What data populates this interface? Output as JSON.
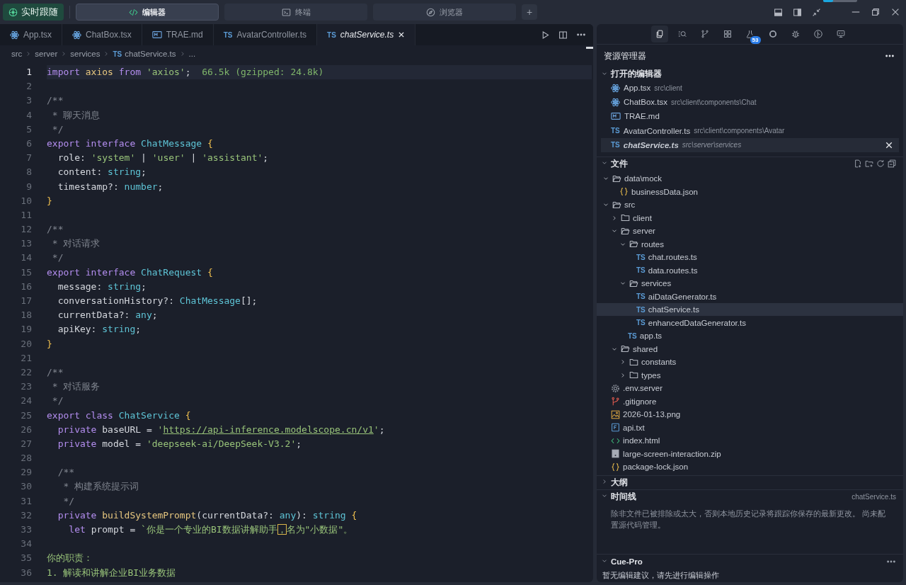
{
  "top_bar": {
    "follow_button": "实时跟随",
    "mode_tabs": [
      {
        "label": "编辑器",
        "kind": "code",
        "selected": true
      },
      {
        "label": "终端",
        "kind": "terminal",
        "selected": false
      },
      {
        "label": "浏览器",
        "kind": "compass",
        "selected": false
      }
    ],
    "add_button": "+",
    "progress": {
      "level": 0.3
    }
  },
  "editor": {
    "tabs": [
      {
        "label": "App.tsx",
        "kind": "react",
        "selected": false
      },
      {
        "label": "ChatBox.tsx",
        "kind": "react",
        "selected": false
      },
      {
        "label": "TRAE.md",
        "kind": "md",
        "selected": false
      },
      {
        "label": "AvatarController.ts",
        "kind": "ts",
        "icon_text": "TS",
        "selected": false
      },
      {
        "label": "chatService.ts",
        "kind": "ts",
        "icon_text": "TS",
        "selected": true
      }
    ],
    "breadcrumb": [
      {
        "text": "src"
      },
      {
        "text": "server"
      },
      {
        "text": "services"
      },
      {
        "text": "chatService.ts",
        "icon_text": "TS"
      },
      {
        "text": "..."
      }
    ],
    "lines": [
      {
        "number": "1",
        "current": true,
        "tokens": [
          {
            "kind": "keyword",
            "text": "import"
          },
          {
            "kind": "variable",
            "text": " axios "
          },
          {
            "kind": "keyword",
            "text": "from"
          },
          {
            "kind": "string",
            "text": " 'axios'"
          },
          {
            "kind": "plain",
            "text": ";"
          },
          {
            "kind": "hint",
            "text": "  66.5k (gzipped: 24.8k)"
          }
        ]
      },
      {
        "number": "2",
        "current": false
      },
      {
        "number": "3",
        "current": false,
        "tokens": [
          {
            "kind": "comment",
            "text": "/**"
          }
        ]
      },
      {
        "number": "4",
        "current": false,
        "tokens": [
          {
            "kind": "comment",
            "text": " * 聊天消息"
          }
        ]
      },
      {
        "number": "5",
        "current": false,
        "tokens": [
          {
            "kind": "comment",
            "text": " */"
          }
        ]
      },
      {
        "number": "6",
        "current": false,
        "tokens": [
          {
            "kind": "keyword",
            "text": "export interface "
          },
          {
            "kind": "class",
            "text": "ChatMessage "
          },
          {
            "kind": "brace",
            "text": "{"
          }
        ]
      },
      {
        "number": "7",
        "current": false,
        "tokens": [
          {
            "kind": "plain",
            "text": "  role: "
          },
          {
            "kind": "string",
            "text": "'system'"
          },
          {
            "kind": "plain",
            "text": " | "
          },
          {
            "kind": "string",
            "text": "'user'"
          },
          {
            "kind": "plain",
            "text": " | "
          },
          {
            "kind": "string",
            "text": "'assistant'"
          },
          {
            "kind": "plain",
            "text": ";"
          }
        ]
      },
      {
        "number": "8",
        "current": false,
        "tokens": [
          {
            "kind": "plain",
            "text": "  content: "
          },
          {
            "kind": "type",
            "text": "string"
          },
          {
            "kind": "plain",
            "text": ";"
          }
        ]
      },
      {
        "number": "9",
        "current": false,
        "tokens": [
          {
            "kind": "plain",
            "text": "  timestamp?: "
          },
          {
            "kind": "type",
            "text": "number"
          },
          {
            "kind": "plain",
            "text": ";"
          }
        ]
      },
      {
        "number": "10",
        "current": false,
        "tokens": [
          {
            "kind": "brace",
            "text": "}"
          }
        ]
      },
      {
        "number": "11",
        "current": false
      },
      {
        "number": "12",
        "current": false,
        "tokens": [
          {
            "kind": "comment",
            "text": "/**"
          }
        ]
      },
      {
        "number": "13",
        "current": false,
        "tokens": [
          {
            "kind": "comment",
            "text": " * 对话请求"
          }
        ]
      },
      {
        "number": "14",
        "current": false,
        "tokens": [
          {
            "kind": "comment",
            "text": " */"
          }
        ]
      },
      {
        "number": "15",
        "current": false,
        "tokens": [
          {
            "kind": "keyword",
            "text": "export interface "
          },
          {
            "kind": "class",
            "text": "ChatRequest "
          },
          {
            "kind": "brace",
            "text": "{"
          }
        ]
      },
      {
        "number": "16",
        "current": false,
        "tokens": [
          {
            "kind": "plain",
            "text": "  message: "
          },
          {
            "kind": "type",
            "text": "string"
          },
          {
            "kind": "plain",
            "text": ";"
          }
        ]
      },
      {
        "number": "17",
        "current": false,
        "tokens": [
          {
            "kind": "plain",
            "text": "  conversationHistory?: "
          },
          {
            "kind": "class",
            "text": "ChatMessage"
          },
          {
            "kind": "plain",
            "text": "[];"
          }
        ]
      },
      {
        "number": "18",
        "current": false,
        "tokens": [
          {
            "kind": "plain",
            "text": "  currentData?: "
          },
          {
            "kind": "type",
            "text": "any"
          },
          {
            "kind": "plain",
            "text": ";"
          }
        ]
      },
      {
        "number": "19",
        "current": false,
        "tokens": [
          {
            "kind": "plain",
            "text": "  apiKey: "
          },
          {
            "kind": "type",
            "text": "string"
          },
          {
            "kind": "plain",
            "text": ";"
          }
        ]
      },
      {
        "number": "20",
        "current": false,
        "tokens": [
          {
            "kind": "brace",
            "text": "}"
          }
        ]
      },
      {
        "number": "21",
        "current": false
      },
      {
        "number": "22",
        "current": false,
        "tokens": [
          {
            "kind": "comment",
            "text": "/**"
          }
        ]
      },
      {
        "number": "23",
        "current": false,
        "tokens": [
          {
            "kind": "comment",
            "text": " * 对话服务"
          }
        ]
      },
      {
        "number": "24",
        "current": false,
        "tokens": [
          {
            "kind": "comment",
            "text": " */"
          }
        ]
      },
      {
        "number": "25",
        "current": false,
        "tokens": [
          {
            "kind": "keyword",
            "text": "export class "
          },
          {
            "kind": "class",
            "text": "ChatService "
          },
          {
            "kind": "brace",
            "text": "{"
          }
        ]
      },
      {
        "number": "26",
        "current": false,
        "tokens": [
          {
            "kind": "keyword",
            "text": "  private "
          },
          {
            "kind": "plain",
            "text": "baseURL = "
          },
          {
            "kind": "string",
            "text": "'"
          },
          {
            "kind": "link",
            "text": "https://api-inference.modelscope.cn/v1"
          },
          {
            "kind": "string",
            "text": "'"
          },
          {
            "kind": "plain",
            "text": ";"
          }
        ]
      },
      {
        "number": "27",
        "current": false,
        "tokens": [
          {
            "kind": "keyword",
            "text": "  private "
          },
          {
            "kind": "plain",
            "text": "model = "
          },
          {
            "kind": "string",
            "text": "'deepseek-ai/DeepSeek-V3.2'"
          },
          {
            "kind": "plain",
            "text": ";"
          }
        ]
      },
      {
        "number": "28",
        "current": false
      },
      {
        "number": "29",
        "current": false,
        "tokens": [
          {
            "kind": "comment",
            "text": "  /**"
          }
        ]
      },
      {
        "number": "30",
        "current": false,
        "tokens": [
          {
            "kind": "comment",
            "text": "   * 构建系统提示词"
          }
        ]
      },
      {
        "number": "31",
        "current": false,
        "tokens": [
          {
            "kind": "comment",
            "text": "   */"
          }
        ]
      },
      {
        "number": "32",
        "current": false,
        "tokens": [
          {
            "kind": "keyword",
            "text": "  private "
          },
          {
            "kind": "function",
            "text": "buildSystemPrompt"
          },
          {
            "kind": "plain",
            "text": "(currentData?: "
          },
          {
            "kind": "type",
            "text": "any"
          },
          {
            "kind": "plain",
            "text": "): "
          },
          {
            "kind": "type",
            "text": "string "
          },
          {
            "kind": "brace",
            "text": "{"
          }
        ]
      },
      {
        "number": "33",
        "current": false,
        "tokens": [
          {
            "kind": "keyword",
            "text": "    let "
          },
          {
            "kind": "plain",
            "text": "prompt = "
          },
          {
            "kind": "string",
            "text": "`你是一个专业的BI数据讲解助手"
          },
          {
            "kind": "match",
            "text": "，"
          },
          {
            "kind": "string",
            "text": "名为\"小数据\"。"
          }
        ]
      },
      {
        "number": "34",
        "current": false
      },
      {
        "number": "35",
        "current": false,
        "tokens": [
          {
            "kind": "string",
            "text": "你的职责："
          }
        ]
      },
      {
        "number": "36",
        "current": false,
        "tokens": [
          {
            "kind": "string",
            "text": "1. 解读和讲解企业BI业务数据"
          }
        ]
      }
    ]
  },
  "side_panel": {
    "activity_icons": [
      {
        "kind": "files",
        "selected": true
      },
      {
        "kind": "search",
        "selected": false
      },
      {
        "kind": "branch",
        "selected": false
      },
      {
        "kind": "grid",
        "selected": false
      },
      {
        "kind": "flask",
        "selected": false,
        "badge": "53"
      },
      {
        "kind": "ring",
        "selected": false
      },
      {
        "kind": "bug",
        "selected": false
      },
      {
        "kind": "graph",
        "selected": false
      },
      {
        "kind": "monitor",
        "selected": false
      }
    ],
    "title": "资源管理器",
    "open_editors": {
      "title": "打开的编辑器",
      "expanded": true,
      "items": [
        {
          "name": "App.tsx",
          "path": "src\\client",
          "kind": "react",
          "selected": false
        },
        {
          "name": "ChatBox.tsx",
          "path": "src\\client\\components\\Chat",
          "kind": "react",
          "selected": false
        },
        {
          "name": "TRAE.md",
          "kind": "md",
          "selected": false
        },
        {
          "name": "AvatarController.ts",
          "path": "src\\client\\components\\Avatar",
          "kind": "ts",
          "icon_text": "TS",
          "selected": false
        },
        {
          "name": "chatService.ts",
          "path": "src\\server\\services",
          "kind": "ts",
          "icon_text": "TS",
          "selected": true
        }
      ]
    },
    "files": {
      "title": "文件",
      "expanded": true,
      "tree": [
        {
          "name": "data\\mock",
          "kind": "folder",
          "expanded": true,
          "children": [
            {
              "name": "businessData.json",
              "kind": "json",
              "selected": false
            }
          ]
        },
        {
          "name": "src",
          "kind": "folder",
          "expanded": true,
          "children": [
            {
              "name": "client",
              "kind": "folder",
              "expanded": false
            },
            {
              "name": "server",
              "kind": "folder",
              "expanded": true,
              "children": [
                {
                  "name": "routes",
                  "kind": "folder",
                  "expanded": true,
                  "children": [
                    {
                      "name": "chat.routes.ts",
                      "kind": "ts",
                      "icon_text": "TS",
                      "selected": false
                    },
                    {
                      "name": "data.routes.ts",
                      "kind": "ts",
                      "icon_text": "TS",
                      "selected": false
                    }
                  ]
                },
                {
                  "name": "services",
                  "kind": "folder",
                  "expanded": true,
                  "children": [
                    {
                      "name": "aiDataGenerator.ts",
                      "kind": "ts",
                      "icon_text": "TS",
                      "selected": false
                    },
                    {
                      "name": "chatService.ts",
                      "kind": "ts",
                      "icon_text": "TS",
                      "selected": true
                    },
                    {
                      "name": "enhancedDataGenerator.ts",
                      "kind": "ts",
                      "icon_text": "TS",
                      "selected": false
                    }
                  ]
                },
                {
                  "name": "app.ts",
                  "kind": "ts",
                  "icon_text": "TS",
                  "selected": false
                }
              ]
            },
            {
              "name": "shared",
              "kind": "folder",
              "expanded": true,
              "children": [
                {
                  "name": "constants",
                  "kind": "folder",
                  "expanded": false
                },
                {
                  "name": "types",
                  "kind": "folder",
                  "expanded": false
                }
              ]
            }
          ]
        },
        {
          "name": ".env.server",
          "kind": "gear",
          "selected": false
        },
        {
          "name": ".gitignore",
          "kind": "git",
          "selected": false
        },
        {
          "name": "2026-01-13.png",
          "kind": "image",
          "selected": false
        },
        {
          "name": "api.txt",
          "kind": "txt",
          "selected": false
        },
        {
          "name": "index.html",
          "kind": "html",
          "selected": false
        },
        {
          "name": "large-screen-interaction.zip",
          "kind": "zip",
          "selected": false
        },
        {
          "name": "package-lock.json",
          "kind": "json",
          "selected": false
        }
      ]
    },
    "outline": {
      "title": "大纲",
      "expanded": false
    },
    "timeline": {
      "title": "时间线",
      "expanded": true,
      "file": "chatService.ts",
      "message": "除非文件已被排除或太大，否则本地历史记录将跟踪你保存的最新更改。 尚未配置源代码管理。"
    },
    "cue_pro": {
      "title": "Cue-Pro",
      "expanded": true,
      "message": "暂无编辑建议，请先进行编辑操作"
    }
  }
}
